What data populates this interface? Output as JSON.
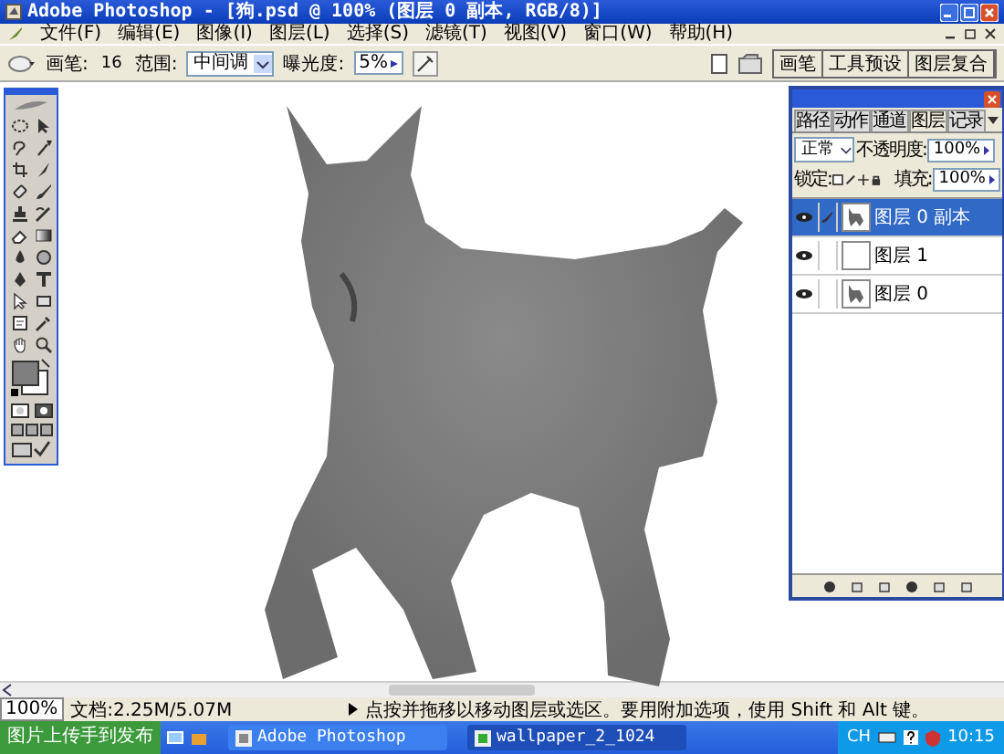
{
  "window": {
    "title": "Adobe Photoshop - [狗.psd @ 100% (图层 0 副本, RGB/8)]"
  },
  "menu": [
    "文件(F)",
    "编辑(E)",
    "图像(I)",
    "图层(L)",
    "选择(S)",
    "滤镜(T)",
    "视图(V)",
    "窗口(W)",
    "帮助(H)"
  ],
  "options_bar": {
    "brush_label": "画笔:",
    "brush_size": "16",
    "range_label": "范围:",
    "range_value": "中间调",
    "exposure_label": "曝光度:",
    "exposure_value": "5%"
  },
  "palette_well": [
    {
      "label": "画笔"
    },
    {
      "label": "工具预设"
    },
    {
      "label": "图层复合"
    }
  ],
  "layers_panel": {
    "tabs": [
      {
        "label": "路径",
        "selected": false
      },
      {
        "label": "动作",
        "selected": false
      },
      {
        "label": "通道",
        "selected": false
      },
      {
        "label": "图层",
        "selected": true
      },
      {
        "label": "记录",
        "selected": false
      }
    ],
    "blend_mode": "正常",
    "opacity_label": "不透明度:",
    "opacity": "100%",
    "lock_label": "锁定:",
    "fill_label": "填充:",
    "fill": "100%",
    "layers": [
      {
        "name": "图层 0 副本",
        "visible": true,
        "selected": true,
        "kind": "image"
      },
      {
        "name": "图层 1",
        "visible": true,
        "selected": false,
        "kind": "blank"
      },
      {
        "name": "图层 0",
        "visible": true,
        "selected": false,
        "kind": "image"
      }
    ]
  },
  "status_bar": {
    "zoom": "100%",
    "doc": "文档:2.25M/5.07M",
    "hint": "点按并拖移以移动图层或选区。要用附加选项，使用 Shift 和 Alt 键。"
  },
  "taskbar": {
    "start": "图片上传手到发布",
    "tasks": [
      {
        "label": "Adobe Photoshop",
        "selected": false
      },
      {
        "label": "wallpaper_2_1024",
        "selected": true
      }
    ],
    "lang": "CH",
    "time": "10:15"
  }
}
